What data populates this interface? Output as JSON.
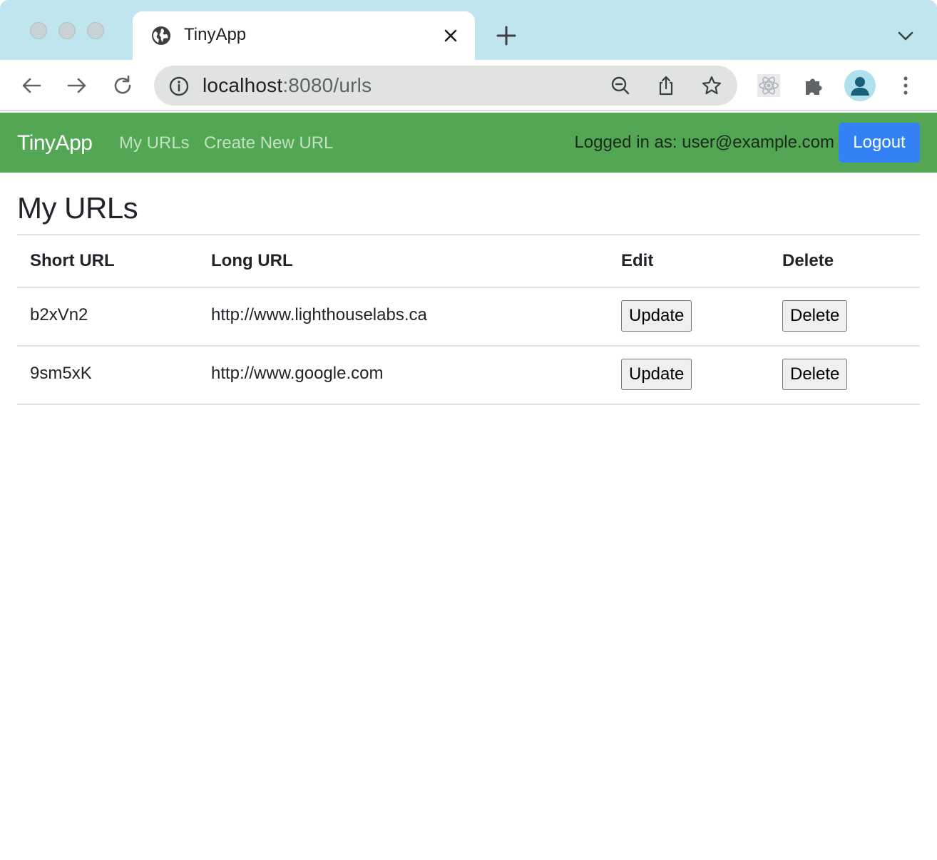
{
  "browser": {
    "tab_title": "TinyApp",
    "address": {
      "host": "localhost",
      "path": ":8080/urls"
    }
  },
  "navbar": {
    "brand": "TinyApp",
    "links": [
      "My URLs",
      "Create New URL"
    ],
    "logged_in_text": "Logged in as: user@example.com",
    "logout_label": "Logout",
    "colors": {
      "background": "#53a653",
      "logout_button": "#3381f5"
    }
  },
  "main": {
    "title": "My URLs",
    "table": {
      "headers": [
        "Short URL",
        "Long URL",
        "Edit",
        "Delete"
      ],
      "rows": [
        {
          "short": "b2xVn2",
          "long": "http://www.lighthouselabs.ca",
          "edit_label": "Update",
          "delete_label": "Delete"
        },
        {
          "short": "9sm5xK",
          "long": "http://www.google.com",
          "edit_label": "Update",
          "delete_label": "Delete"
        }
      ]
    }
  }
}
